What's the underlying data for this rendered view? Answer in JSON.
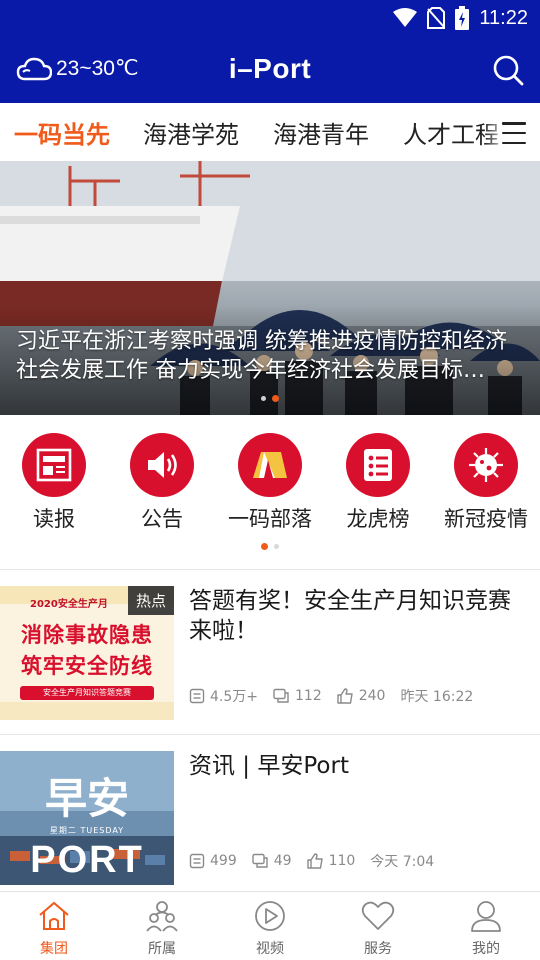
{
  "status_bar": {
    "time": "11:22"
  },
  "app_bar": {
    "weather": {
      "icon": "cloud-icon",
      "temp_range": "23~30℃"
    },
    "title": "i–Port",
    "search_icon": "search-icon"
  },
  "tabs": [
    {
      "label": "一码当先",
      "active": true
    },
    {
      "label": "海港学苑",
      "active": false
    },
    {
      "label": "海港青年",
      "active": false
    },
    {
      "label": "人才工程",
      "active": false
    }
  ],
  "menu_icon": "menu-icon",
  "banner": {
    "caption": "习近平在浙江考察时强调 统筹推进疫情防控和经济社会发展工作 奋力实现今年经济社会发展目标…",
    "page_count": 2,
    "active_page": 2
  },
  "quick_entries": [
    {
      "label": "读报",
      "icon": "newspaper-icon"
    },
    {
      "label": "公告",
      "icon": "speaker-icon"
    },
    {
      "label": "一码部落",
      "icon": "tent-icon"
    },
    {
      "label": "龙虎榜",
      "icon": "list-icon"
    },
    {
      "label": "新冠疫情",
      "icon": "virus-icon"
    }
  ],
  "quick_pages": {
    "count": 2,
    "active": 1
  },
  "news": [
    {
      "badge": "热点",
      "title": "答题有奖！安全生产月知识竞赛来啦！",
      "thumb": {
        "year_line": "2020安全生产月",
        "line1": "消除事故隐患",
        "line2": "筑牢安全防线",
        "footer": "安全生产月知识答题竞赛"
      },
      "reads": "4.5万+",
      "comments": "112",
      "likes": "240",
      "time": "昨天 16:22"
    },
    {
      "badge": "",
      "title": "资讯 | 早安Port",
      "thumb": {
        "big": "早安",
        "sub": "星期二 TUESDAY",
        "word": "PORT"
      },
      "reads": "499",
      "comments": "49",
      "likes": "110",
      "time": "今天 7:04"
    }
  ],
  "bottom_nav": [
    {
      "label": "集团",
      "icon": "home-icon",
      "active": true
    },
    {
      "label": "所属",
      "icon": "group-icon",
      "active": false
    },
    {
      "label": "视频",
      "icon": "play-icon",
      "active": false
    },
    {
      "label": "服务",
      "icon": "heart-icon",
      "active": false
    },
    {
      "label": "我的",
      "icon": "user-icon",
      "active": false
    }
  ],
  "colors": {
    "header_blue": "#0a1aa8",
    "accent_orange": "#f05a1a",
    "icon_red": "#d8102e"
  }
}
